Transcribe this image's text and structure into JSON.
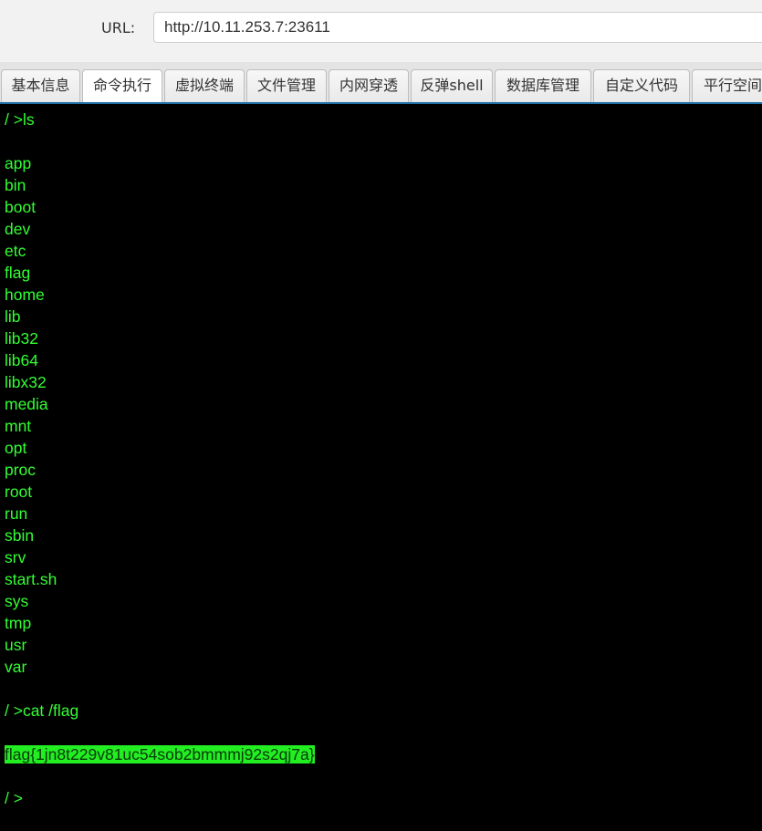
{
  "url_bar": {
    "label": "URL:",
    "value": "http://10.11.253.7:23611"
  },
  "tabs": [
    {
      "label": "基本信息",
      "active": false
    },
    {
      "label": "命令执行",
      "active": true
    },
    {
      "label": "虚拟终端",
      "active": false
    },
    {
      "label": "文件管理",
      "active": false
    },
    {
      "label": "内网穿透",
      "active": false
    },
    {
      "label": "反弹shell",
      "active": false
    },
    {
      "label": "数据库管理",
      "active": false
    },
    {
      "label": "自定义代码",
      "active": false
    },
    {
      "label": "平行空间",
      "active": false
    }
  ],
  "terminal": {
    "prompt1": "/ >ls",
    "ls_output": [
      "app",
      "bin",
      "boot",
      "dev",
      "etc",
      "flag",
      "home",
      "lib",
      "lib32",
      "lib64",
      "libx32",
      "media",
      "mnt",
      "opt",
      "proc",
      "root",
      "run",
      "sbin",
      "srv",
      "start.sh",
      "sys",
      "tmp",
      "usr",
      "var"
    ],
    "prompt2": "/ >cat /flag",
    "flag": "flag{1jn8t229v81uc54sob2bmmmj92s2qj7a}",
    "prompt3": "/ >"
  },
  "colors": {
    "terminal_text": "#33ff33",
    "terminal_bg": "#000000",
    "highlight_bg": "#22ee22",
    "tab_border_accent": "#1d6fa5"
  }
}
